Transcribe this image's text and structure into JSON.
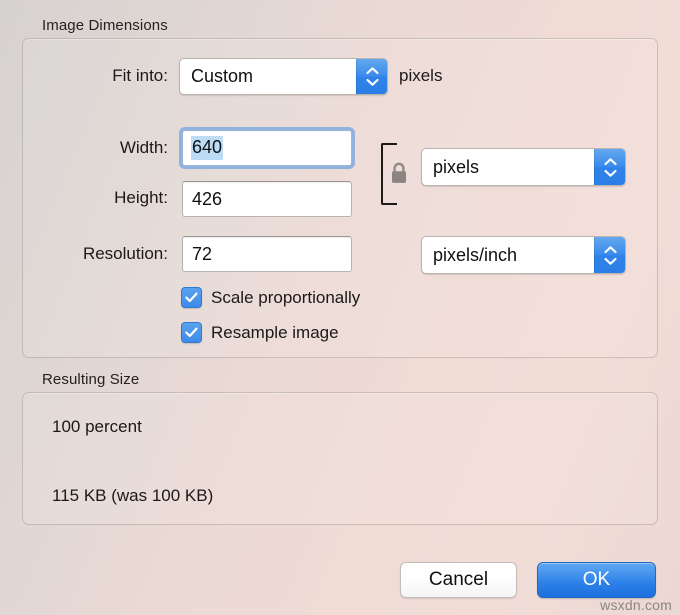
{
  "sections": {
    "dimensions": {
      "title": "Image Dimensions",
      "fit_into": {
        "label": "Fit into:",
        "value": "Custom",
        "suffix_unit": "pixels"
      },
      "width": {
        "label": "Width:",
        "value": "640",
        "selected": true
      },
      "height": {
        "label": "Height:",
        "value": "426"
      },
      "size_unit": {
        "value": "pixels"
      },
      "resolution": {
        "label": "Resolution:",
        "value": "72"
      },
      "resolution_unit": {
        "value": "pixels/inch"
      },
      "link_lock": {
        "icon": "lock-closed-icon",
        "state": "locked"
      },
      "checkboxes": [
        {
          "label": "Scale proportionally",
          "checked": true
        },
        {
          "label": "Resample image",
          "checked": true
        }
      ]
    },
    "resulting_size": {
      "title": "Resulting Size",
      "percent_line": "100 percent",
      "size_line": "115 KB (was 100 KB)"
    }
  },
  "buttons": {
    "cancel": "Cancel",
    "ok": "OK"
  },
  "watermark": "wsxdn.com",
  "colors": {
    "accent_blue": "#3a8bea",
    "selection_blue": "#bcdcf6",
    "focus_ring": "#7aa7de",
    "text": "#1c1917"
  }
}
